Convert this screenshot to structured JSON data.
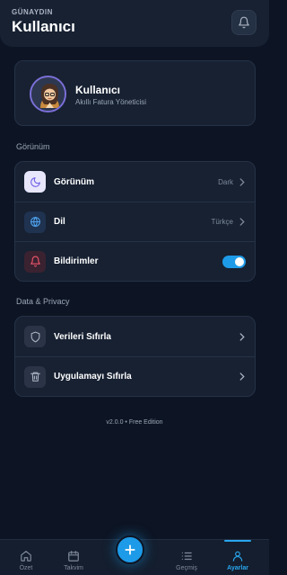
{
  "header": {
    "greeting": "GÜNAYDIN",
    "title": "Kullanıcı",
    "bell_icon": "bell-icon"
  },
  "profile": {
    "name": "Kullanıcı",
    "subtitle": "Akıllı Fatura Yöneticisi",
    "avatar": "avatar-illustration"
  },
  "sections": {
    "appearance_title": "Görünüm",
    "privacy_title": "Data & Privacy"
  },
  "settings": [
    {
      "label": "Görünüm",
      "value": "Dark",
      "icon": "moon-icon"
    },
    {
      "label": "Dil",
      "value": "Türkçe",
      "icon": "globe-icon"
    },
    {
      "label": "Bildirimler",
      "value": "",
      "icon": "bell-icon",
      "toggle": true
    }
  ],
  "privacy": [
    {
      "label": "Verileri Sıfırla",
      "icon": "shield-icon"
    },
    {
      "label": "Uygulamayı Sıfırla",
      "icon": "trash-icon"
    }
  ],
  "version": "v2.0.0 • Free Edition",
  "tabs": [
    {
      "label": "Özet",
      "icon": "home-icon"
    },
    {
      "label": "Takvim",
      "icon": "calendar-icon"
    },
    {
      "label": "Geçmiş",
      "icon": "list-icon"
    },
    {
      "label": "Ayarlar",
      "icon": "user-icon",
      "active": true
    }
  ],
  "fab_icon": "plus-icon",
  "colors": {
    "accent": "#1e9be8",
    "background": "#0d1524",
    "card": "#172132"
  }
}
